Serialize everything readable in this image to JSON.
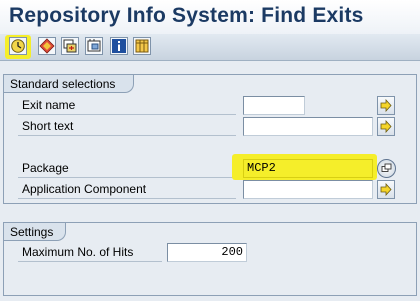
{
  "window": {
    "title": "Repository Info System: Find Exits"
  },
  "toolbar": {
    "buttons": [
      {
        "icon": "execute-clock-icon"
      },
      {
        "icon": "diamond-icon"
      },
      {
        "icon": "layers-icon"
      },
      {
        "icon": "selection-icon"
      },
      {
        "icon": "info-icon"
      },
      {
        "icon": "table-icon"
      }
    ]
  },
  "standard_selections": {
    "title": "Standard selections",
    "fields": [
      {
        "label": "Exit name",
        "value": ""
      },
      {
        "label": "Short text",
        "value": ""
      },
      {
        "label": "Package",
        "value": "MCP2"
      },
      {
        "label": "Application Component",
        "value": ""
      }
    ]
  },
  "settings": {
    "title": "Settings",
    "max_hits_label": "Maximum No. of Hits",
    "max_hits_value": "200"
  },
  "colors": {
    "highlight": "#f5ee2a",
    "title": "#1b3a63"
  }
}
